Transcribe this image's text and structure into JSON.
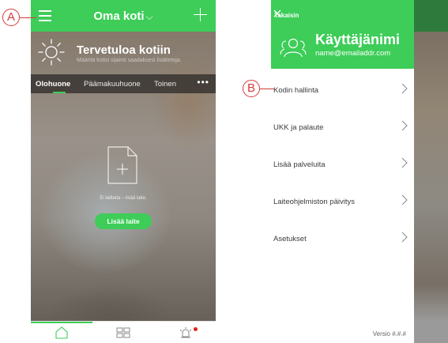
{
  "annotations": {
    "a": "A",
    "b": "B"
  },
  "home": {
    "title": "Oma koti",
    "welcome_title": "Tervetuloa kotiin",
    "welcome_sub": "Määritä kotisi sijainti saadaksesi lisätietoja.",
    "tabs": [
      {
        "label": "Olohuone",
        "active": true
      },
      {
        "label": "Päämakuuhuone",
        "active": false
      },
      {
        "label": "Toinen",
        "active": false
      }
    ],
    "more_label": "•••",
    "empty_text": "Ei laitteita – lisää laite.",
    "add_device_label": "Lisää laite",
    "nav": [
      "home-icon",
      "grid-icon",
      "alarm-icon"
    ]
  },
  "drawer": {
    "back_label": "Takaisin",
    "username": "Käyttäjänimi",
    "email": "name@emailaddr.com",
    "items": [
      {
        "label": "Kodin hallinta"
      },
      {
        "label": "UKK ja palaute"
      },
      {
        "label": "Lisää palveluita"
      },
      {
        "label": "Laiteohjelmiston päivitys"
      },
      {
        "label": "Asetukset"
      }
    ],
    "version": "Versio #.#.#"
  },
  "colors": {
    "accent": "#3dcd58",
    "callout": "#d63a3a",
    "alarm_dot": "#e2231a"
  }
}
